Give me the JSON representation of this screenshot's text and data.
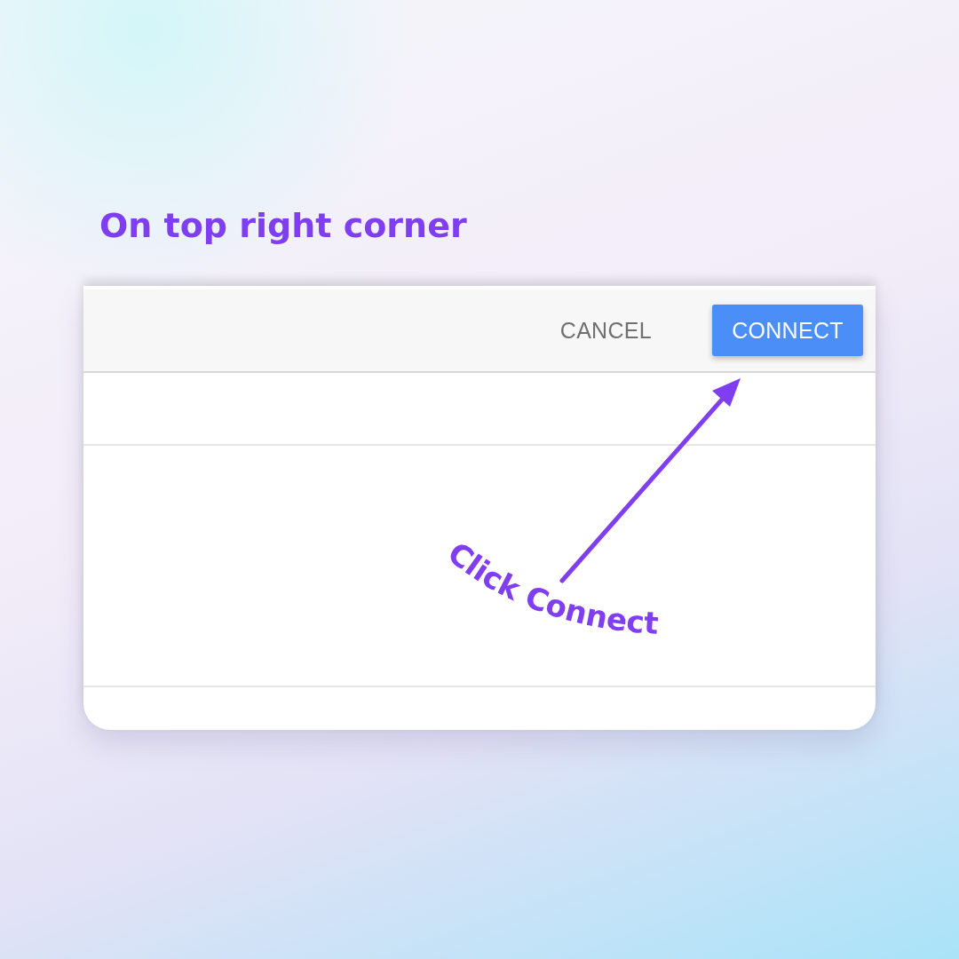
{
  "heading": "On top right corner",
  "dialog": {
    "buttons": [
      {
        "label": "CANCEL",
        "kind": "text"
      },
      {
        "label": "CONNECT",
        "kind": "primary"
      }
    ]
  },
  "annotation": {
    "text": "Click Connect"
  }
}
